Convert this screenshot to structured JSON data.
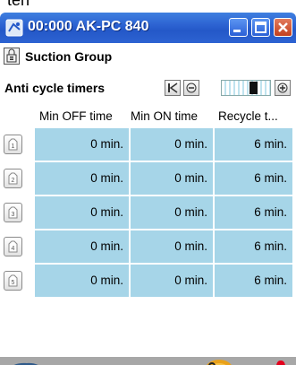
{
  "top_clip_text": "ten",
  "window": {
    "title": "00:000 AK-PC 840",
    "app_icon": "app-logo-icon",
    "buttons": {
      "minimize": "minimize-icon",
      "maximize": "maximize-icon",
      "close": "close-icon"
    }
  },
  "group": {
    "icon": "group-lock-icon",
    "title": "Suction Group"
  },
  "timers": {
    "title": "Anti cycle timers",
    "nav": {
      "first": "first-page-icon",
      "prev": "previous-page-icon",
      "next": "next-page-icon"
    },
    "scroll_position": 0.7
  },
  "table": {
    "columns": [
      "Min OFF time",
      "Min ON time",
      "Recycle t..."
    ],
    "rows": [
      {
        "index": "1",
        "values": [
          "0 min.",
          "0 min.",
          "6 min."
        ]
      },
      {
        "index": "2",
        "values": [
          "0 min.",
          "0 min.",
          "6 min."
        ]
      },
      {
        "index": "3",
        "values": [
          "0 min.",
          "0 min.",
          "6 min."
        ]
      },
      {
        "index": "4",
        "values": [
          "0 min.",
          "0 min.",
          "6 min."
        ]
      },
      {
        "index": "5",
        "values": [
          "0 min.",
          "0 min.",
          "6 min."
        ]
      }
    ]
  },
  "footer": {
    "left_icon": "tools-login-icon",
    "wrench_icon": "wrench-icon",
    "alarm_icon": "alarm-bell-icon"
  },
  "colors": {
    "titlebar": "#2d63d2",
    "cell": "#a6d5e8",
    "footer": "#a7a7a7",
    "alarm": "#e3001b"
  }
}
